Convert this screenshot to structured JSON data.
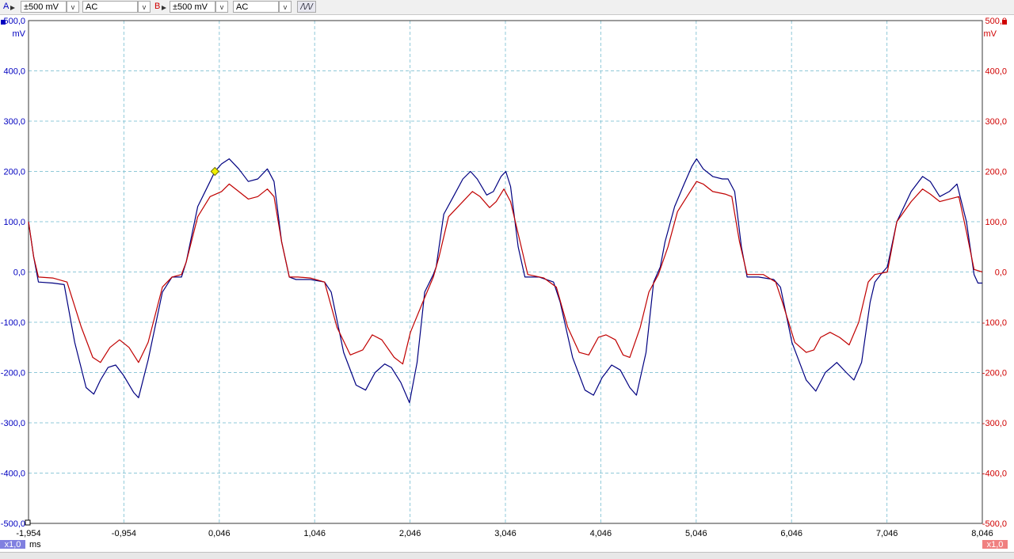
{
  "toolbar": {
    "channel_a": {
      "letter": "A",
      "range": "±500 mV",
      "coupling": "AC",
      "color": "#0000c0"
    },
    "channel_b": {
      "letter": "B",
      "range": "±500 mV",
      "coupling": "AC",
      "color": "#d00000"
    },
    "dropdown_arrow": "v",
    "trigger_button": "/\\/\\/"
  },
  "chart_data": {
    "type": "line",
    "x_unit": "ms",
    "y_unit_left": "mV",
    "y_unit_right": "mV",
    "xlim": [
      -1.954,
      8.046
    ],
    "ylim": [
      -500,
      500
    ],
    "x_ticks": [
      "-1,954",
      "-0,954",
      "0,046",
      "1,046",
      "2,046",
      "3,046",
      "4,046",
      "5,046",
      "6,046",
      "7,046",
      "8,046"
    ],
    "y_ticks": [
      "500,0",
      "400,0",
      "300,0",
      "200,0",
      "100,0",
      "0,0",
      "-100,0",
      "-200,0",
      "-300,0",
      "-400,0",
      "-500,0"
    ],
    "zoom_left": "x1,0",
    "zoom_right": "x1,0",
    "grid": true,
    "trigger_marker": {
      "x": 0.0,
      "y": 200
    },
    "series": [
      {
        "channel": "A",
        "color": "#000080",
        "points": [
          [
            -1.954,
            100
          ],
          [
            -1.9,
            30
          ],
          [
            -1.85,
            -20
          ],
          [
            -1.7,
            -22
          ],
          [
            -1.58,
            -25
          ],
          [
            -1.47,
            -140
          ],
          [
            -1.35,
            -230
          ],
          [
            -1.27,
            -243
          ],
          [
            -1.2,
            -215
          ],
          [
            -1.12,
            -190
          ],
          [
            -1.04,
            -185
          ],
          [
            -0.96,
            -205
          ],
          [
            -0.85,
            -240
          ],
          [
            -0.8,
            -250
          ],
          [
            -0.7,
            -175
          ],
          [
            -0.55,
            -40
          ],
          [
            -0.45,
            -10
          ],
          [
            -0.35,
            -10
          ],
          [
            -0.3,
            20
          ],
          [
            -0.18,
            130
          ],
          [
            -0.05,
            180
          ],
          [
            0.0,
            200
          ],
          [
            0.07,
            215
          ],
          [
            0.15,
            225
          ],
          [
            0.25,
            205
          ],
          [
            0.35,
            180
          ],
          [
            0.45,
            185
          ],
          [
            0.55,
            205
          ],
          [
            0.62,
            180
          ],
          [
            0.7,
            60
          ],
          [
            0.78,
            -10
          ],
          [
            0.85,
            -15
          ],
          [
            1.0,
            -15
          ],
          [
            1.15,
            -20
          ],
          [
            1.22,
            -40
          ],
          [
            1.35,
            -160
          ],
          [
            1.48,
            -225
          ],
          [
            1.58,
            -235
          ],
          [
            1.68,
            -200
          ],
          [
            1.78,
            -183
          ],
          [
            1.85,
            -190
          ],
          [
            1.95,
            -220
          ],
          [
            2.04,
            -260
          ],
          [
            2.12,
            -180
          ],
          [
            2.2,
            -40
          ],
          [
            2.29,
            -5
          ],
          [
            2.32,
            10
          ],
          [
            2.4,
            115
          ],
          [
            2.5,
            150
          ],
          [
            2.6,
            185
          ],
          [
            2.68,
            200
          ],
          [
            2.75,
            185
          ],
          [
            2.85,
            153
          ],
          [
            2.92,
            160
          ],
          [
            3.0,
            190
          ],
          [
            3.05,
            200
          ],
          [
            3.1,
            170
          ],
          [
            3.18,
            50
          ],
          [
            3.25,
            -10
          ],
          [
            3.4,
            -10
          ],
          [
            3.55,
            -20
          ],
          [
            3.62,
            -60
          ],
          [
            3.75,
            -170
          ],
          [
            3.88,
            -235
          ],
          [
            3.97,
            -245
          ],
          [
            4.06,
            -210
          ],
          [
            4.16,
            -185
          ],
          [
            4.25,
            -195
          ],
          [
            4.35,
            -230
          ],
          [
            4.42,
            -245
          ],
          [
            4.52,
            -160
          ],
          [
            4.6,
            -20
          ],
          [
            4.67,
            10
          ],
          [
            4.72,
            60
          ],
          [
            4.82,
            130
          ],
          [
            4.92,
            175
          ],
          [
            5.0,
            210
          ],
          [
            5.05,
            225
          ],
          [
            5.12,
            205
          ],
          [
            5.22,
            190
          ],
          [
            5.32,
            185
          ],
          [
            5.38,
            185
          ],
          [
            5.45,
            160
          ],
          [
            5.52,
            50
          ],
          [
            5.58,
            -10
          ],
          [
            5.7,
            -10
          ],
          [
            5.86,
            -15
          ],
          [
            5.93,
            -30
          ],
          [
            6.05,
            -140
          ],
          [
            6.2,
            -215
          ],
          [
            6.3,
            -237
          ],
          [
            6.4,
            -200
          ],
          [
            6.52,
            -180
          ],
          [
            6.62,
            -200
          ],
          [
            6.7,
            -215
          ],
          [
            6.78,
            -180
          ],
          [
            6.87,
            -60
          ],
          [
            6.92,
            -20
          ],
          [
            6.98,
            -5
          ],
          [
            7.05,
            10
          ],
          [
            7.15,
            100
          ],
          [
            7.3,
            160
          ],
          [
            7.42,
            190
          ],
          [
            7.5,
            180
          ],
          [
            7.6,
            150
          ],
          [
            7.7,
            160
          ],
          [
            7.78,
            175
          ],
          [
            7.88,
            100
          ],
          [
            7.96,
            -5
          ],
          [
            8.0,
            -22
          ],
          [
            8.046,
            -22
          ]
        ]
      },
      {
        "channel": "B",
        "color": "#c00000",
        "points": [
          [
            -1.954,
            100
          ],
          [
            -1.9,
            30
          ],
          [
            -1.85,
            -10
          ],
          [
            -1.7,
            -12
          ],
          [
            -1.55,
            -20
          ],
          [
            -1.4,
            -110
          ],
          [
            -1.28,
            -170
          ],
          [
            -1.2,
            -180
          ],
          [
            -1.1,
            -150
          ],
          [
            -1.0,
            -135
          ],
          [
            -0.9,
            -150
          ],
          [
            -0.8,
            -180
          ],
          [
            -0.7,
            -140
          ],
          [
            -0.55,
            -30
          ],
          [
            -0.45,
            -10
          ],
          [
            -0.35,
            -5
          ],
          [
            -0.3,
            20
          ],
          [
            -0.18,
            110
          ],
          [
            -0.05,
            150
          ],
          [
            0.07,
            160
          ],
          [
            0.15,
            175
          ],
          [
            0.25,
            160
          ],
          [
            0.35,
            145
          ],
          [
            0.45,
            150
          ],
          [
            0.55,
            165
          ],
          [
            0.62,
            150
          ],
          [
            0.7,
            60
          ],
          [
            0.78,
            -10
          ],
          [
            0.87,
            -10
          ],
          [
            1.0,
            -12
          ],
          [
            1.15,
            -20
          ],
          [
            1.28,
            -110
          ],
          [
            1.42,
            -165
          ],
          [
            1.55,
            -155
          ],
          [
            1.65,
            -125
          ],
          [
            1.75,
            -135
          ],
          [
            1.88,
            -170
          ],
          [
            1.97,
            -183
          ],
          [
            2.05,
            -120
          ],
          [
            2.18,
            -60
          ],
          [
            2.29,
            -10
          ],
          [
            2.35,
            30
          ],
          [
            2.45,
            110
          ],
          [
            2.6,
            140
          ],
          [
            2.7,
            160
          ],
          [
            2.78,
            150
          ],
          [
            2.88,
            128
          ],
          [
            2.95,
            140
          ],
          [
            3.03,
            165
          ],
          [
            3.1,
            140
          ],
          [
            3.2,
            60
          ],
          [
            3.28,
            -5
          ],
          [
            3.45,
            -12
          ],
          [
            3.58,
            -30
          ],
          [
            3.7,
            -110
          ],
          [
            3.82,
            -160
          ],
          [
            3.92,
            -165
          ],
          [
            4.02,
            -130
          ],
          [
            4.1,
            -125
          ],
          [
            4.2,
            -135
          ],
          [
            4.28,
            -165
          ],
          [
            4.35,
            -170
          ],
          [
            4.46,
            -110
          ],
          [
            4.55,
            -40
          ],
          [
            4.65,
            -5
          ],
          [
            4.75,
            50
          ],
          [
            4.85,
            120
          ],
          [
            4.95,
            150
          ],
          [
            5.05,
            180
          ],
          [
            5.12,
            175
          ],
          [
            5.22,
            160
          ],
          [
            5.35,
            155
          ],
          [
            5.42,
            150
          ],
          [
            5.5,
            60
          ],
          [
            5.58,
            -5
          ],
          [
            5.75,
            -5
          ],
          [
            5.88,
            -20
          ],
          [
            5.95,
            -60
          ],
          [
            6.08,
            -140
          ],
          [
            6.2,
            -160
          ],
          [
            6.28,
            -155
          ],
          [
            6.35,
            -130
          ],
          [
            6.45,
            -120
          ],
          [
            6.55,
            -130
          ],
          [
            6.65,
            -145
          ],
          [
            6.75,
            -100
          ],
          [
            6.85,
            -20
          ],
          [
            6.92,
            -5
          ],
          [
            7.05,
            0
          ],
          [
            7.15,
            100
          ],
          [
            7.3,
            140
          ],
          [
            7.42,
            165
          ],
          [
            7.5,
            155
          ],
          [
            7.6,
            140
          ],
          [
            7.7,
            145
          ],
          [
            7.8,
            150
          ],
          [
            7.88,
            80
          ],
          [
            7.96,
            5
          ],
          [
            8.046,
            0
          ]
        ]
      }
    ]
  }
}
